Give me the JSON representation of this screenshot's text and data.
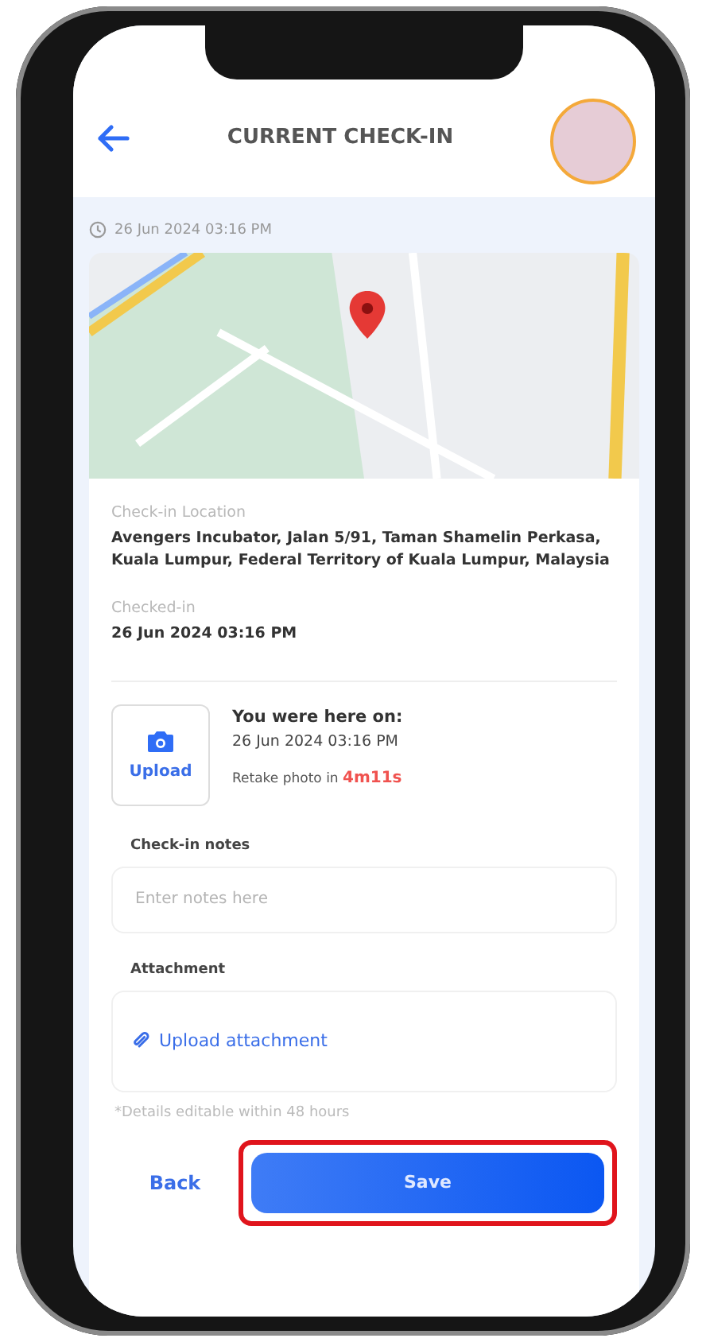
{
  "header": {
    "title": "CURRENT CHECK-IN"
  },
  "timestamp": "26 Jun 2024 03:16 PM",
  "details": [
    {
      "label": "Check-in Location",
      "value": "Avengers Incubator, Jalan 5/91, Taman Shamelin Perkasa, Kuala Lumpur, Federal Territory of Kuala Lumpur, Malaysia"
    },
    {
      "label": "Checked-in",
      "value": "26 Jun 2024 03:16 PM"
    }
  ],
  "photo": {
    "upload_label": "Upload",
    "heading": "You were here on:",
    "time": "26 Jun 2024 03:16 PM",
    "retake_text": "Retake photo in",
    "countdown": "4m11s"
  },
  "notes": {
    "label": "Check-in notes",
    "placeholder": "Enter notes here"
  },
  "attachment": {
    "label": "Attachment",
    "action": "Upload attachment"
  },
  "footnote": "*Details editable within 48 hours",
  "buttons": {
    "back": "Back",
    "save": "Save",
    "save_highlighted": true
  }
}
